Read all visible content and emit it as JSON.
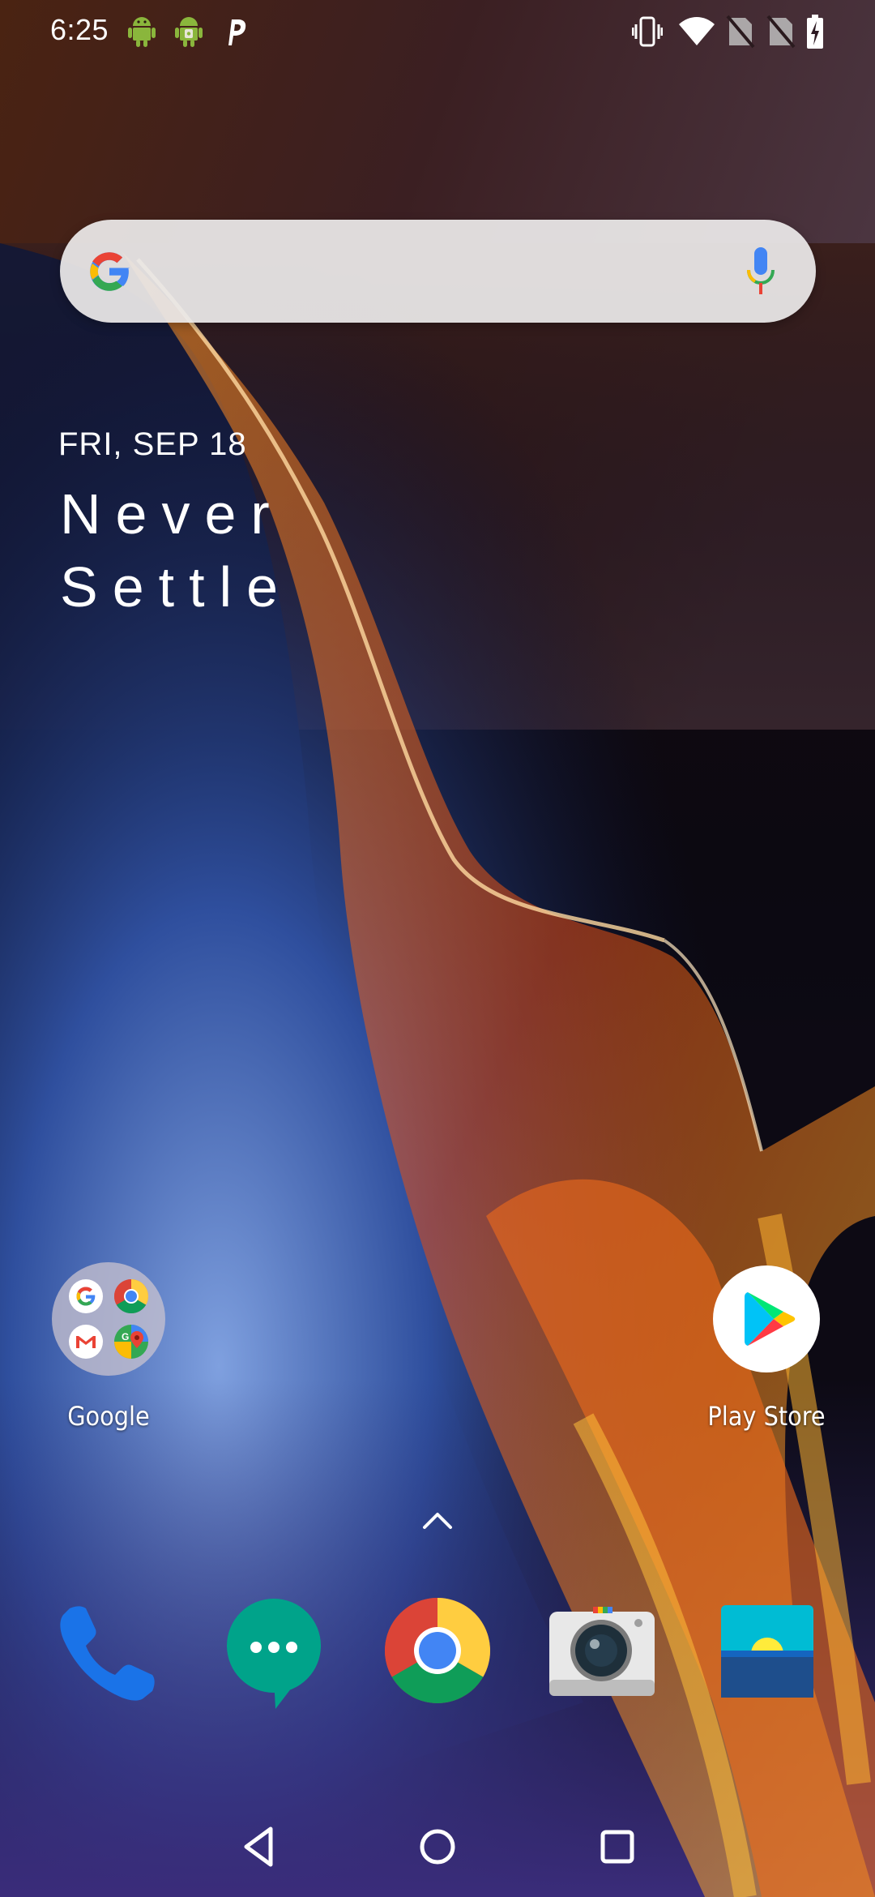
{
  "status_bar": {
    "time": "6:25",
    "left_icons": [
      "android-icon",
      "android-debug-icon",
      "p-app-icon"
    ],
    "right_icons": [
      "vibrate-icon",
      "wifi-icon",
      "no-sim-icon",
      "no-sim-icon",
      "battery-charging-icon"
    ]
  },
  "search": {
    "placeholder": "",
    "left_icon": "google-g-icon",
    "right_icon": "mic-icon"
  },
  "date_widget": {
    "date": "FRI, SEP 18",
    "slogan_line1": "Never",
    "slogan_line2": "Settle"
  },
  "home_apps": [
    {
      "label": "Google",
      "icon": "google-folder-icon",
      "folder_apps": [
        "google-icon",
        "chrome-icon",
        "gmail-icon",
        "maps-icon"
      ]
    },
    {
      "label": "Play Store",
      "icon": "play-store-icon"
    }
  ],
  "drawer_handle": {
    "icon": "chevron-up-icon"
  },
  "dock": [
    {
      "icon": "phone-icon"
    },
    {
      "icon": "messages-icon"
    },
    {
      "icon": "chrome-icon"
    },
    {
      "icon": "camera-icon"
    },
    {
      "icon": "gallery-icon"
    }
  ],
  "nav_bar": {
    "buttons": [
      "back-icon",
      "home-icon",
      "recents-icon"
    ]
  },
  "colors": {
    "google_blue": "#4285F4",
    "google_red": "#EA4335",
    "google_yellow": "#FBBC05",
    "google_green": "#34A853",
    "messages_teal": "#00A38A",
    "phone_blue": "#1A73E8"
  }
}
